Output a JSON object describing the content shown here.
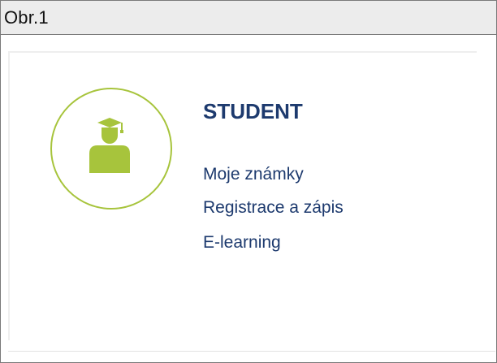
{
  "figure": {
    "caption": "Obr.1"
  },
  "card": {
    "icon": "student-graduate-icon",
    "accent_color": "#a7c43c",
    "text_color": "#1d3a6e",
    "title": "STUDENT",
    "links": [
      {
        "label": "Moje známky"
      },
      {
        "label": "Registrace a zápis"
      },
      {
        "label": "E-learning"
      }
    ]
  }
}
